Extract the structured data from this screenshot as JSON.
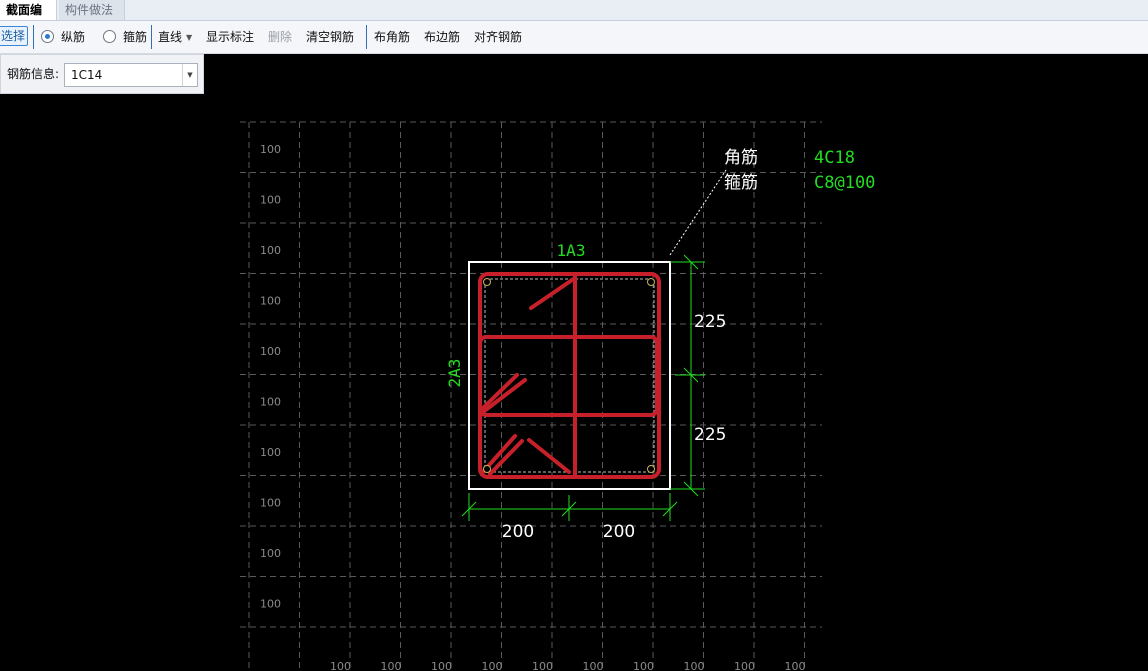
{
  "tabs": {
    "active": "截面编辑",
    "inactive": "构件做法"
  },
  "toolbar": {
    "select": "选择",
    "longitudinal": "纵筋",
    "stirrup": "箍筋",
    "line": "直线",
    "show_annotation": "显示标注",
    "delete": "删除",
    "clear_rebar": "清空钢筋",
    "corner_rebar": "布角筋",
    "edge_rebar": "布边筋",
    "align_rebar": "对齐钢筋"
  },
  "rebar_info": {
    "label": "钢筋信息:",
    "value": "1C14"
  },
  "section": {
    "grid_label": "100",
    "top_edge_label": "1A3",
    "left_edge_label": "2A3",
    "corner_label": "角筋",
    "corner_value": "4C18",
    "stirrup_label": "箍筋",
    "stirrup_value": "C8@100",
    "right_dims": [
      "225",
      "225"
    ],
    "bottom_dims": [
      "200",
      "200"
    ]
  },
  "colors": {
    "rebar": "#c8202a",
    "dimension": "#22dd22",
    "outline": "#ffffff",
    "grid": "#5a5a5a"
  }
}
